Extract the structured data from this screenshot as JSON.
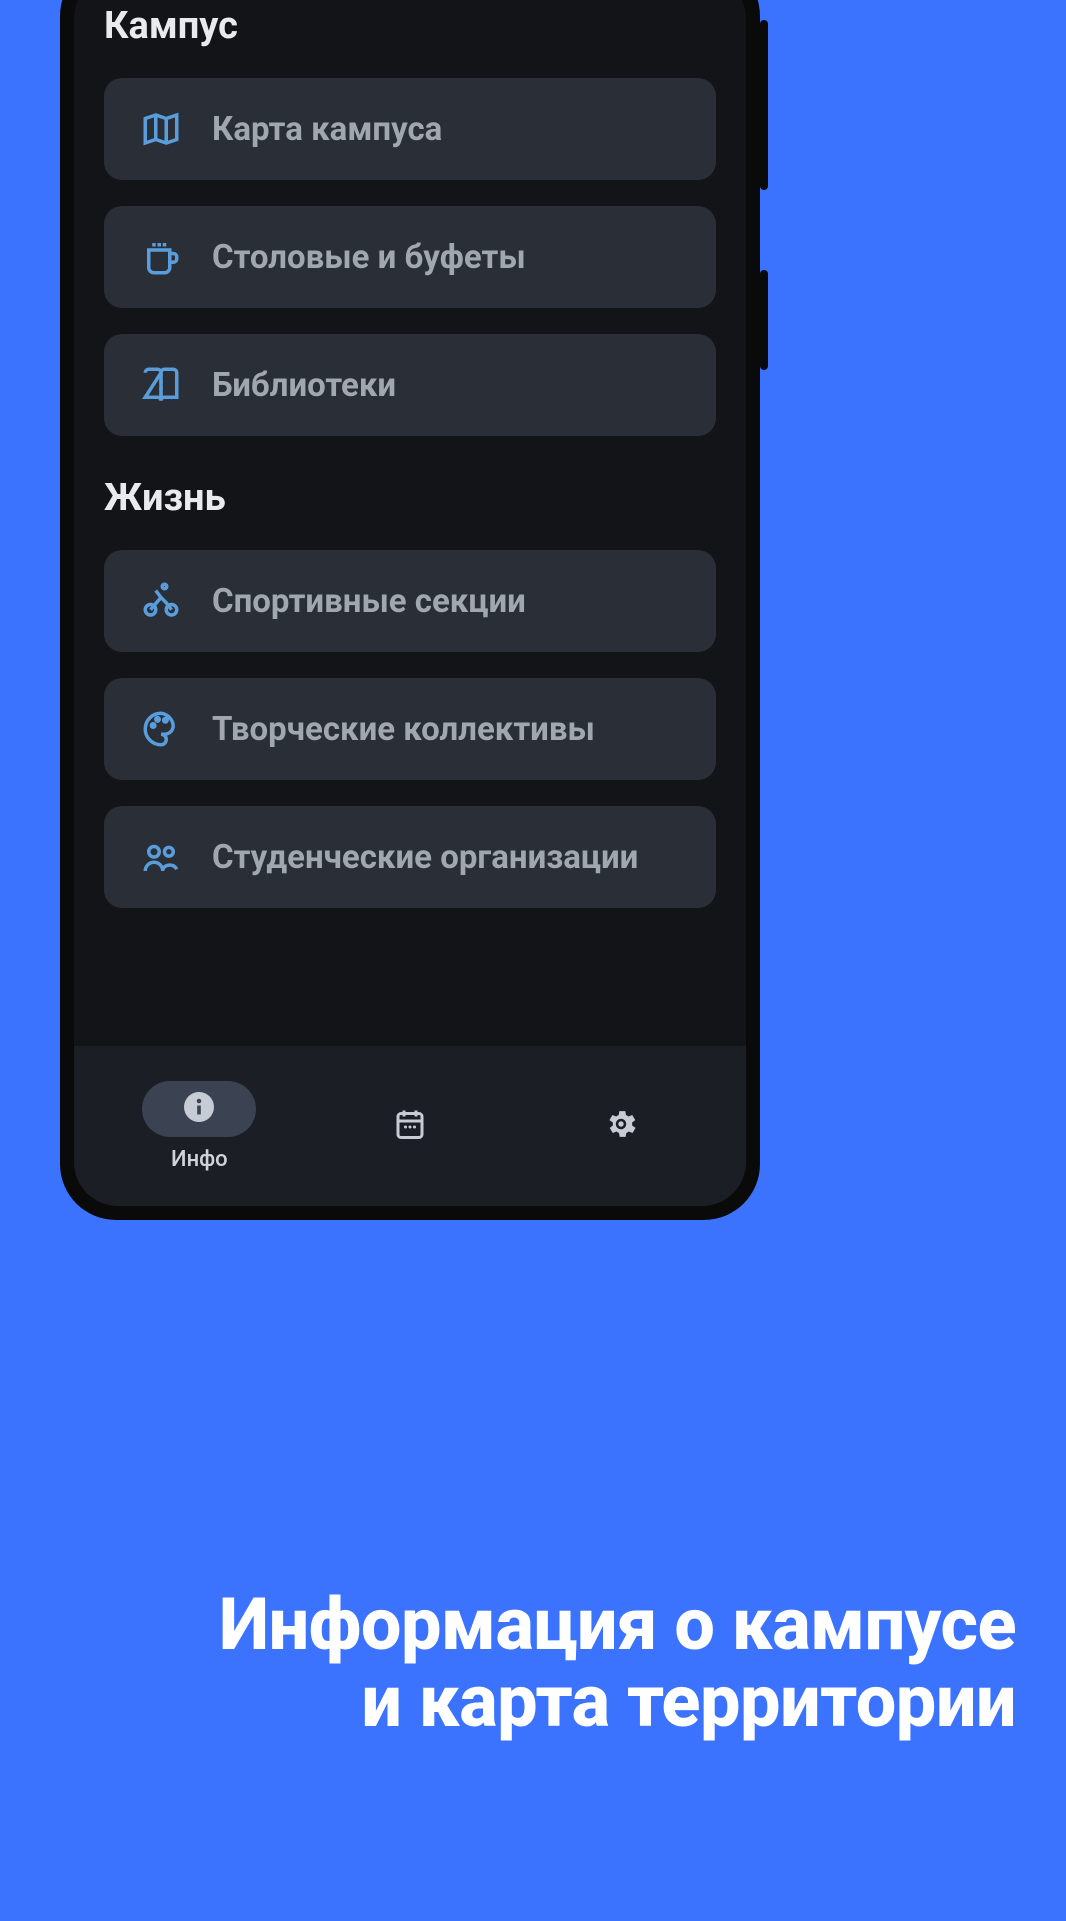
{
  "sections": [
    {
      "title": "Кампус",
      "items": [
        {
          "icon": "map-icon",
          "label": "Карта кампуса"
        },
        {
          "icon": "cup-icon",
          "label": "Столовые и буфеты"
        },
        {
          "icon": "book-icon",
          "label": "Библиотеки"
        }
      ]
    },
    {
      "title": "Жизнь",
      "items": [
        {
          "icon": "bike-icon",
          "label": "Спортивные секции"
        },
        {
          "icon": "palette-icon",
          "label": "Творческие коллективы"
        },
        {
          "icon": "group-icon",
          "label": "Студенческие организации"
        }
      ]
    }
  ],
  "nav": {
    "items": [
      {
        "icon": "info-icon",
        "label": "Инфо",
        "active": true
      },
      {
        "icon": "calendar-icon",
        "label": "",
        "active": false
      },
      {
        "icon": "gear-icon",
        "label": "",
        "active": false
      }
    ]
  },
  "caption": {
    "line1": "Информация о кампусе",
    "line2": "и карта территории"
  }
}
